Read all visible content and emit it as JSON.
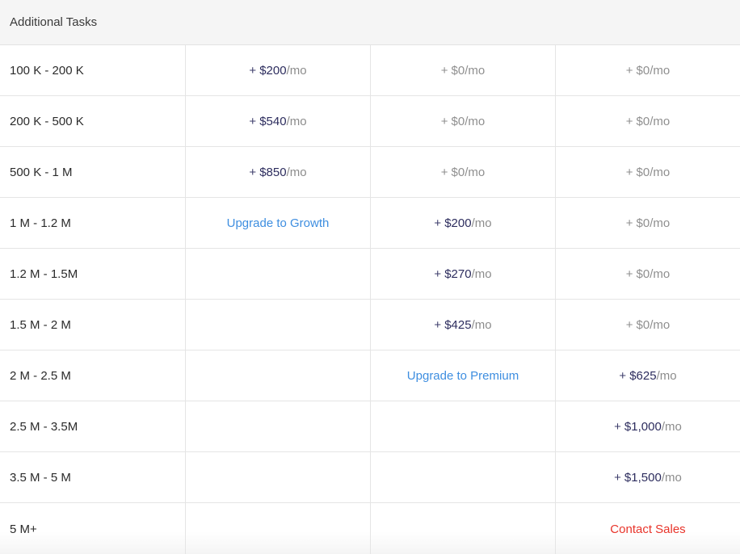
{
  "header": {
    "title": "Additional Tasks"
  },
  "rows": [
    {
      "label": "100 K - 200 K",
      "c1": {
        "plus": "+",
        "amount": "$200",
        "unit": "/mo"
      },
      "c2": {
        "plus": "+",
        "amount": "$0",
        "unit": "/mo"
      },
      "c3": {
        "plus": "+",
        "amount": "$0",
        "unit": "/mo"
      }
    },
    {
      "label": "200 K - 500 K",
      "c1": {
        "plus": "+",
        "amount": "$540",
        "unit": "/mo"
      },
      "c2": {
        "plus": "+",
        "amount": "$0",
        "unit": "/mo"
      },
      "c3": {
        "plus": "+",
        "amount": "$0",
        "unit": "/mo"
      }
    },
    {
      "label": "500 K - 1 M",
      "c1": {
        "plus": "+",
        "amount": "$850",
        "unit": "/mo"
      },
      "c2": {
        "plus": "+",
        "amount": "$0",
        "unit": "/mo"
      },
      "c3": {
        "plus": "+",
        "amount": "$0",
        "unit": "/mo"
      }
    },
    {
      "label": "1 M - 1.2 M",
      "c1_link": "Upgrade to Growth",
      "c2": {
        "plus": "+",
        "amount": "$200",
        "unit": "/mo"
      },
      "c3": {
        "plus": "+",
        "amount": "$0",
        "unit": "/mo"
      }
    },
    {
      "label": "1.2 M - 1.5M",
      "c2": {
        "plus": "+",
        "amount": "$270",
        "unit": "/mo"
      },
      "c3": {
        "plus": "+",
        "amount": "$0",
        "unit": "/mo"
      }
    },
    {
      "label": "1.5 M - 2 M",
      "c2": {
        "plus": "+",
        "amount": "$425",
        "unit": "/mo"
      },
      "c3": {
        "plus": "+",
        "amount": "$0",
        "unit": "/mo"
      }
    },
    {
      "label": "2 M - 2.5 M",
      "c2_link": "Upgrade to Premium",
      "c3": {
        "plus": "+",
        "amount": "$625",
        "unit": "/mo"
      }
    },
    {
      "label": "2.5 M - 3.5M",
      "c3": {
        "plus": "+",
        "amount": "$1,000",
        "unit": "/mo"
      }
    },
    {
      "label": "3.5 M - 5 M",
      "c3": {
        "plus": "+",
        "amount": "$1,500",
        "unit": "/mo"
      }
    },
    {
      "label": "5 M+",
      "c3_link": "Contact Sales"
    }
  ],
  "colors": {
    "header_bg": "#f5f5f5",
    "price_active": "#2d2d5e",
    "price_muted": "#8f8f8f",
    "link_blue": "#3e8ee0",
    "link_red": "#e8342a"
  }
}
